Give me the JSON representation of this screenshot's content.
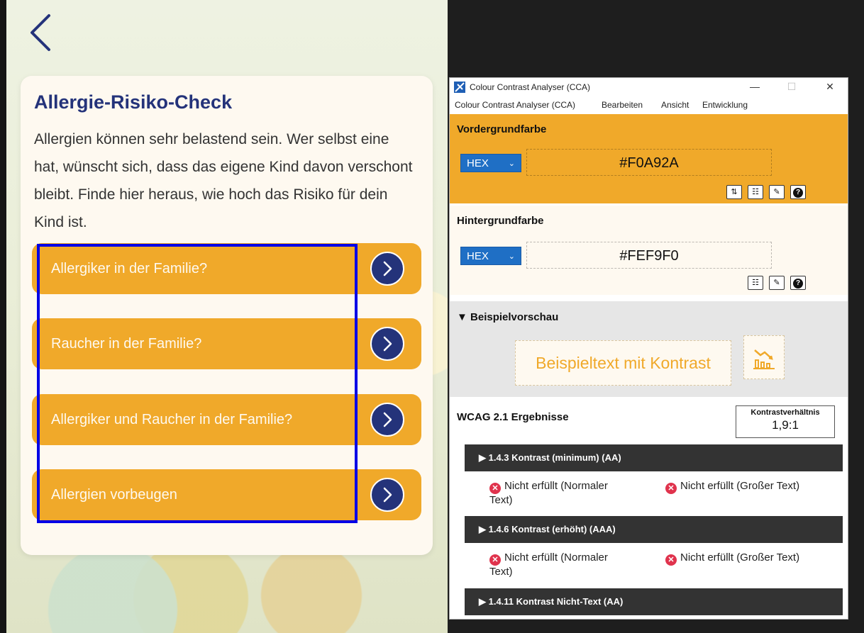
{
  "app": {
    "card_title": "Allergie-Risiko-Check",
    "card_text": "Allergien können sehr belastend sein. Wer selbst eine hat, wünscht sich, dass das eigene Kind davon verschont bleibt. Finde hier heraus, wie hoch das Risiko für dein Kind ist.",
    "menu_items": [
      {
        "label": "Allergiker in der Familie?"
      },
      {
        "label": "Raucher in der Familie?"
      },
      {
        "label": "Allergiker und Raucher in der Familie?"
      },
      {
        "label": "Allergien vorbeugen"
      }
    ],
    "colors": {
      "accent": "#f0a92a",
      "navy": "#24337a",
      "card": "#fef9f0",
      "highlight": "#0000e6"
    }
  },
  "cca": {
    "title": "Colour Contrast Analyser (CCA)",
    "menu": [
      "Colour Contrast Analyser (CCA)",
      "Bearbeiten",
      "Ansicht",
      "Entwicklung"
    ],
    "foreground": {
      "label": "Vordergrundfarbe",
      "format": "HEX",
      "value": "#F0A92A"
    },
    "background": {
      "label": "Hintergrundfarbe",
      "format": "HEX",
      "value": "#FEF9F0"
    },
    "preview": {
      "label": "▼ Beispielvorschau",
      "text": "Beispieltext mit Kontrast"
    },
    "results": {
      "title": "WCAG 2.1 Ergebnisse",
      "ratio_label": "Kontrastverhältnis",
      "ratio_value": "1,9:1",
      "criteria": [
        {
          "label": "▶ 1.4.3 Kontrast (minimum) (AA)",
          "normal_line1": "Nicht erfüllt (Normaler",
          "normal_line2": "Text)",
          "large": "Nicht erfüllt (Großer Text)"
        },
        {
          "label": "▶ 1.4.6 Kontrast (erhöht) (AAA)",
          "normal_line1": "Nicht erfüllt (Normaler",
          "normal_line2": "Text)",
          "large": "Nicht erfüllt (Großer Text)"
        },
        {
          "label": "▶ 1.4.11 Kontrast Nicht-Text (AA)"
        }
      ]
    },
    "icons": {
      "swap": "swap-arrows-icon",
      "sliders": "sliders-icon",
      "eyedropper": "eyedropper-icon",
      "help": "help-icon",
      "chart": "chart-icon"
    }
  }
}
